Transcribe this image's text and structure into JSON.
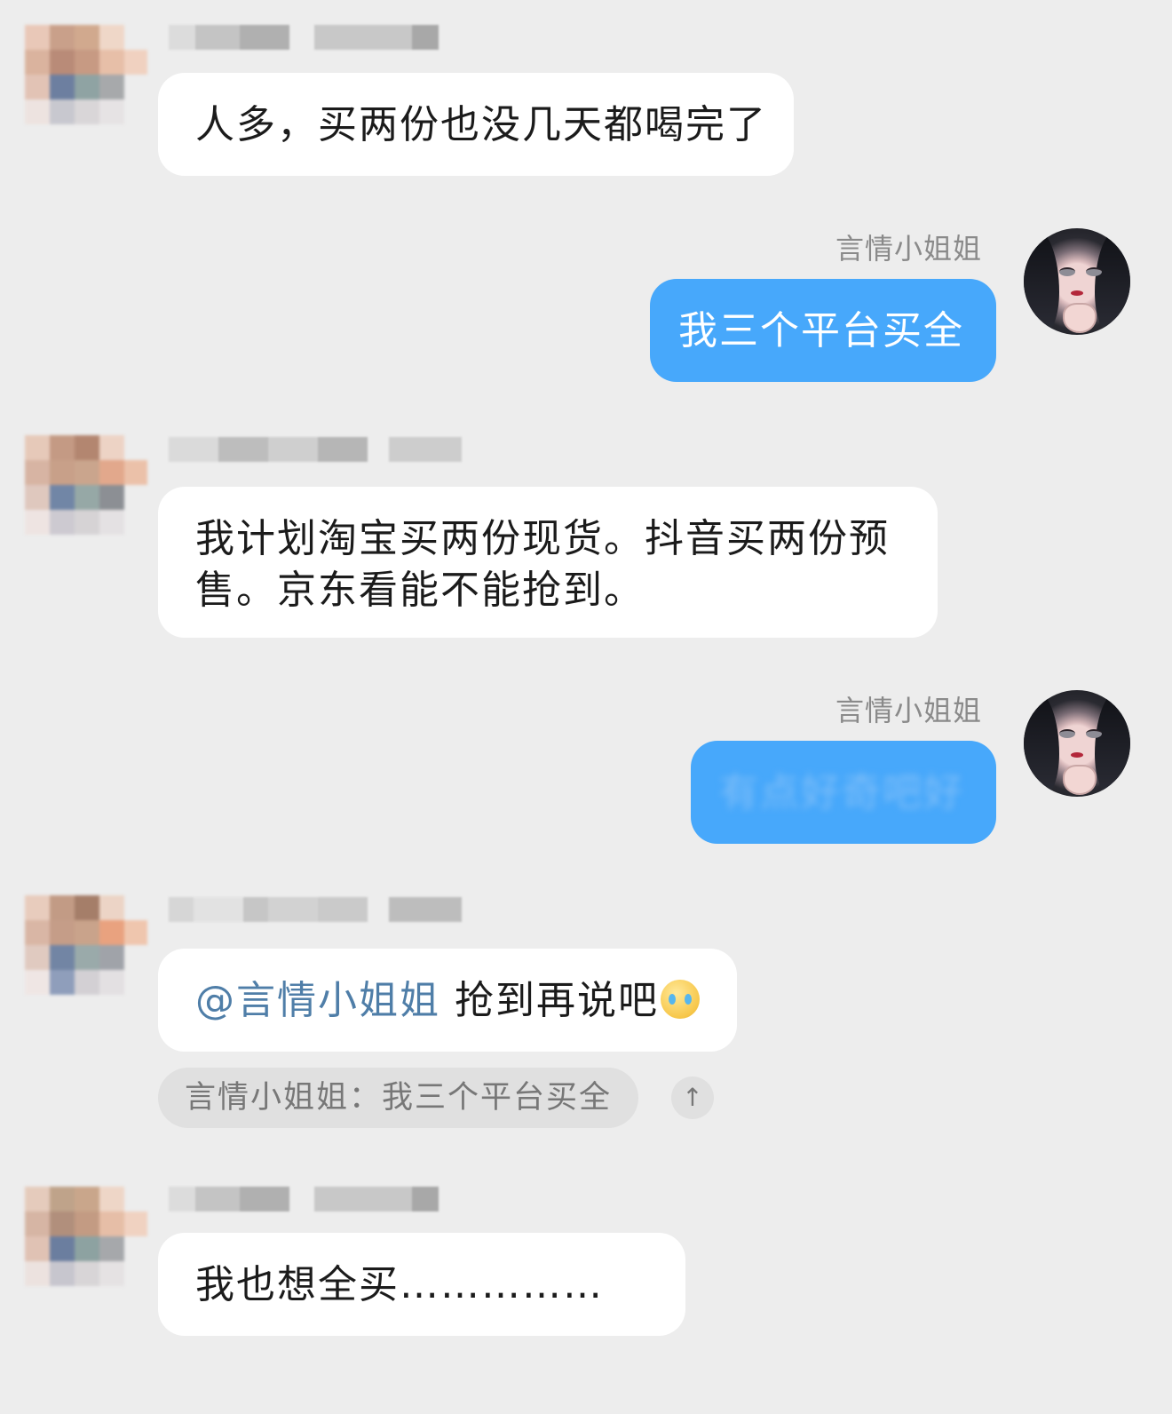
{
  "chat": {
    "messages": [
      {
        "direction": "in",
        "sender": "",
        "text": "人多，买两份也没几天都喝完了"
      },
      {
        "direction": "out",
        "sender": "言情小姐姐",
        "text": "我三个平台买全"
      },
      {
        "direction": "in",
        "sender": "",
        "text_line1": "我计划淘宝买两份现货。抖音买两份预",
        "text_line2": "售。京东看能不能抢到。"
      },
      {
        "direction": "out",
        "sender": "言情小姐姐",
        "text": "有点好奇吧好"
      },
      {
        "direction": "in",
        "sender": "",
        "mention": "@言情小姐姐",
        "text": " 抢到再说吧",
        "emoji": "crying-face-emoji",
        "quote": {
          "author": "言情小姐姐",
          "separator": "：",
          "text": "我三个平台买全"
        }
      },
      {
        "direction": "in",
        "sender": "",
        "text": "我也想全买……………"
      }
    ]
  },
  "icons": {
    "jump_to_quote": "↑"
  }
}
